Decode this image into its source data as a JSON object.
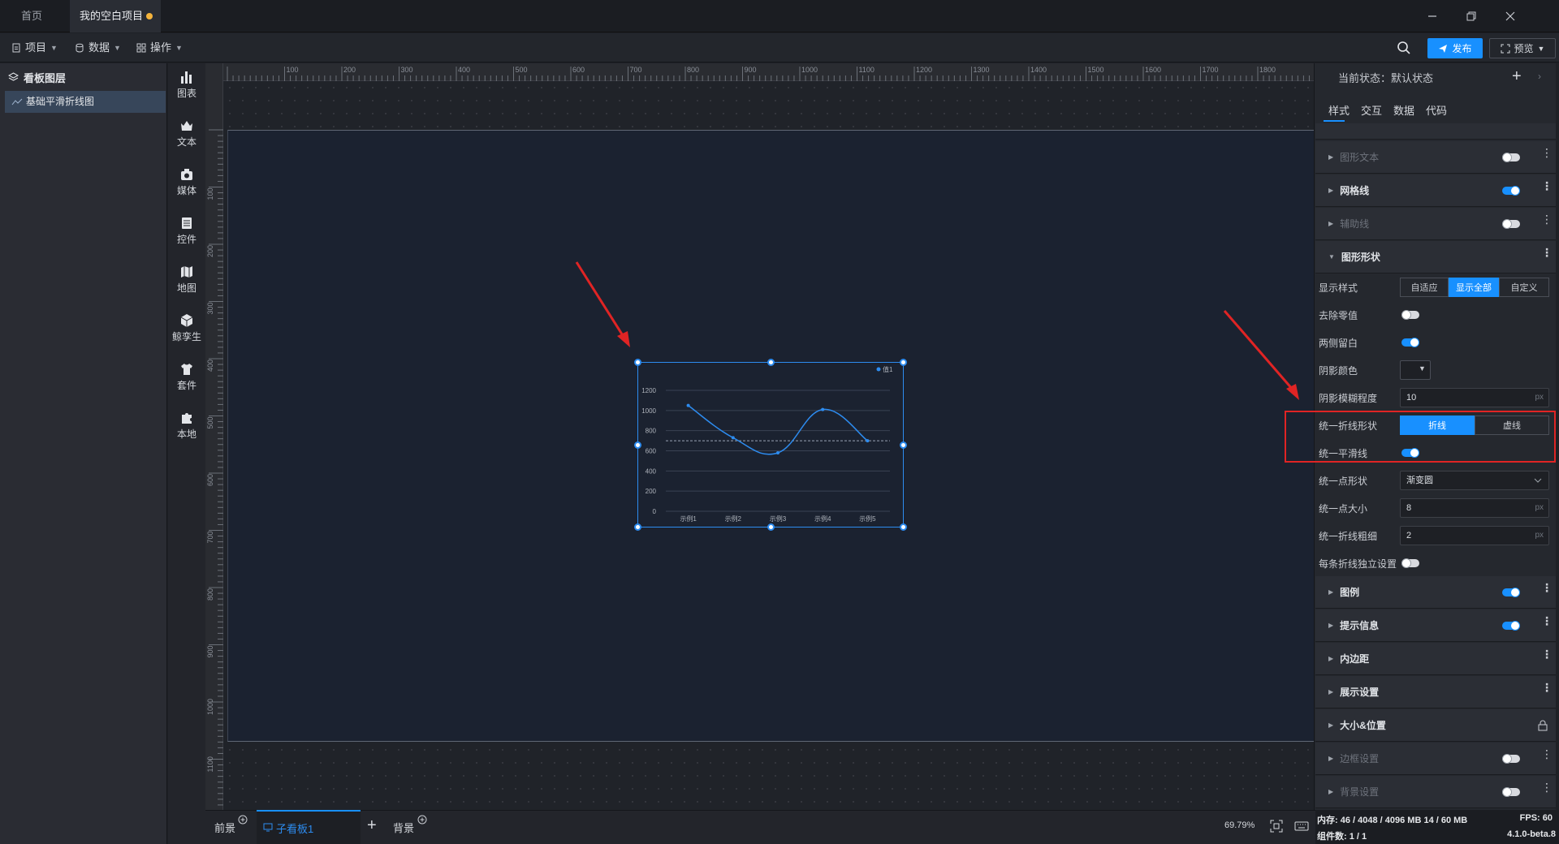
{
  "titlebar": {
    "tabs": [
      "首页",
      "我的空白项目"
    ],
    "window_controls": [
      "minimize-icon",
      "restore-icon",
      "close-icon"
    ]
  },
  "menubar": {
    "items": [
      "项目",
      "数据",
      "操作"
    ],
    "publish": "发布",
    "preview": "预览"
  },
  "layers": {
    "title": "看板图层",
    "items": [
      "基础平滑折线图"
    ]
  },
  "toolbar": {
    "tools": [
      "图表",
      "文本",
      "媒体",
      "控件",
      "地图",
      "鲸孪生",
      "套件",
      "本地"
    ]
  },
  "ruler": {
    "top": [
      "100",
      "200",
      "300",
      "400",
      "500",
      "600",
      "700",
      "800",
      "900",
      "1000",
      "1100",
      "1200",
      "1300",
      "1400",
      "1500",
      "1600",
      "1700",
      "1800",
      "1900"
    ],
    "left": [
      "100",
      "200",
      "300",
      "400",
      "500",
      "600",
      "700",
      "800",
      "900",
      "1000",
      "1100"
    ]
  },
  "chart_data": {
    "type": "line",
    "categories": [
      "示例1",
      "示例2",
      "示例3",
      "示例4",
      "示例5"
    ],
    "series": [
      {
        "name": "值1",
        "values": [
          1050,
          730,
          580,
          1010,
          700
        ]
      }
    ],
    "yticks": [
      "0",
      "200",
      "400",
      "600",
      "800",
      "1000",
      "1200"
    ],
    "ylim": [
      0,
      1200
    ],
    "avg_line": 700,
    "smooth": true,
    "color": "#2d8cf0",
    "grid": true,
    "legend": "top-right"
  },
  "right_panel": {
    "state_label": "当前状态：",
    "state_value": "默认状态",
    "tabs": [
      "样式",
      "交互",
      "数据",
      "代码"
    ],
    "sections_top": [
      {
        "label": "图形文本",
        "dim": true
      },
      {
        "label": "网格线",
        "dim": false
      },
      {
        "label": "辅助线",
        "dim": true
      },
      {
        "label": "图形形状",
        "dim": false
      }
    ],
    "props": {
      "display_style": {
        "label": "显示样式",
        "options": [
          "自适应",
          "显示全部",
          "自定义"
        ],
        "selected": "显示全部"
      },
      "remove_zero": {
        "label": "去除零值",
        "on": false
      },
      "side_gap": {
        "label": "两侧留白",
        "on": true
      },
      "shadow_color": {
        "label": "阴影颜色"
      },
      "shadow_blur": {
        "label": "阴影模糊程度",
        "value": "10",
        "unit": "px"
      },
      "line_shape": {
        "label": "统一折线形状",
        "options": [
          "折线",
          "虚线"
        ],
        "selected": "折线"
      },
      "smooth": {
        "label": "统一平滑线",
        "on": true
      },
      "point_shape": {
        "label": "统一点形状",
        "value": "渐变圆"
      },
      "point_size": {
        "label": "统一点大小",
        "value": "8",
        "unit": "px"
      },
      "line_width": {
        "label": "统一折线粗细",
        "value": "2",
        "unit": "px"
      },
      "independent": {
        "label": "每条折线独立设置",
        "on": false
      }
    },
    "sections_bottom": [
      {
        "label": "图例",
        "dim": false
      },
      {
        "label": "提示信息",
        "dim": false
      },
      {
        "label": "内边距",
        "dim": false
      },
      {
        "label": "展示设置",
        "dim": false
      },
      {
        "label": "大小&位置",
        "dim": false
      },
      {
        "label": "边框设置",
        "dim": true
      },
      {
        "label": "背景设置",
        "dim": true
      }
    ]
  },
  "bottombar": {
    "front": "前景",
    "board": "子看板1",
    "back": "背景",
    "zoom": "69.79%"
  },
  "status": {
    "memory": "内存:  46 / 4048 / 4096 MB  14 / 60 MB",
    "fps": "FPS:  60",
    "components": "组件数: 1 / 1",
    "version": "4.1.0-beta.8"
  }
}
